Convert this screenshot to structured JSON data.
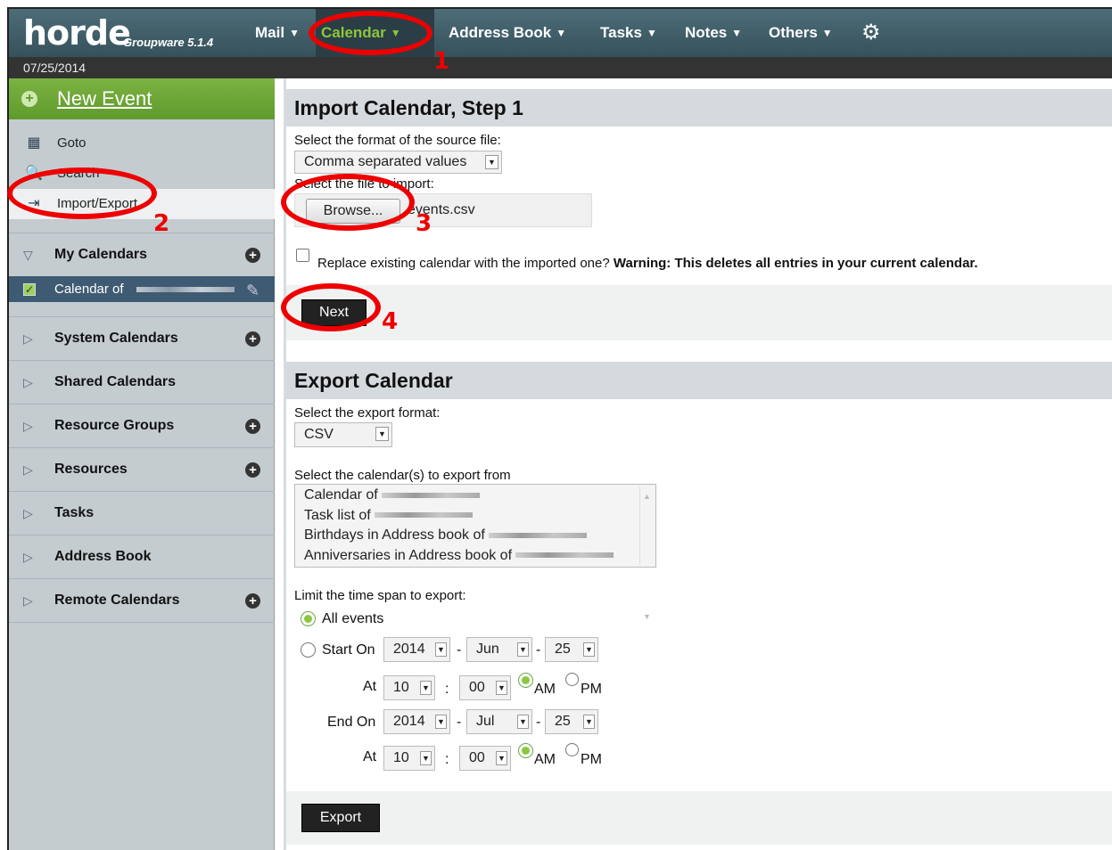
{
  "app": {
    "logo": "horde",
    "version": "Groupware 5.1.4",
    "date": "07/25/2014"
  },
  "menu": [
    {
      "label": "Mail"
    },
    {
      "label": "Calendar"
    },
    {
      "label": "Address Book"
    },
    {
      "label": "Tasks"
    },
    {
      "label": "Notes"
    },
    {
      "label": "Others"
    }
  ],
  "sidebar": {
    "new_event": "New Event",
    "links": [
      {
        "label": "Goto"
      },
      {
        "label": "Search"
      },
      {
        "label": "Import/Export"
      }
    ],
    "sections": [
      {
        "label": "My Calendars"
      },
      {
        "label": "System Calendars"
      },
      {
        "label": "Shared Calendars"
      },
      {
        "label": "Resource Groups"
      },
      {
        "label": "Resources"
      },
      {
        "label": "Tasks"
      },
      {
        "label": "Address Book"
      },
      {
        "label": "Remote Calendars"
      }
    ],
    "calendar_item": "Calendar of"
  },
  "import": {
    "title": "Import Calendar, Step 1",
    "format_label": "Select the format of the source file:",
    "format_value": "Comma separated values",
    "file_label": "Select the file to import:",
    "browse": "Browse...",
    "file_name": "events.csv",
    "replace_label": "Replace existing calendar with the imported one?",
    "warning": "Warning: This deletes all entries in your current calendar.",
    "next": "Next"
  },
  "export": {
    "title": "Export Calendar",
    "format_label": "Select the export format:",
    "format_value": "CSV",
    "calendars_label": "Select the calendar(s) to export from",
    "calendars": [
      "Calendar of",
      "Task list of",
      "Birthdays in Address book of",
      "Anniversaries in Address book of"
    ],
    "timespan_label": "Limit the time span to export:",
    "all_events": "All events",
    "start_on": "Start On",
    "end_on": "End On",
    "at": "At",
    "start": {
      "year": "2014",
      "month": "Jun",
      "day": "25",
      "hour": "10",
      "minute": "00"
    },
    "end": {
      "year": "2014",
      "month": "Jul",
      "day": "25",
      "hour": "10",
      "minute": "00"
    },
    "am": "AM",
    "pm": "PM",
    "dash": "-",
    "colon": ":",
    "export_button": "Export"
  },
  "annotations": [
    "1",
    "2",
    "3",
    "4"
  ],
  "colors": {
    "annotation": "#e00000",
    "accent": "#8dc63f",
    "topbar": "#3f5d68"
  }
}
